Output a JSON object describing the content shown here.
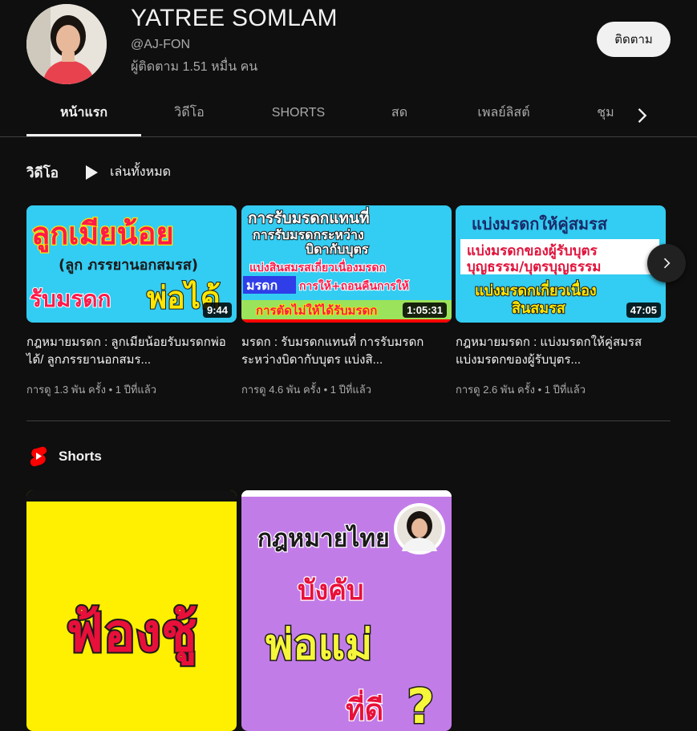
{
  "channel": {
    "name": "YATREE SOMLAM",
    "handle": "@AJ-FON",
    "subscribers": "ผู้ติดตาม 1.51 หมื่น คน",
    "subscribe_label": "ติดตาม"
  },
  "tabs": [
    "หน้าแรก",
    "วิดีโอ",
    "SHORTS",
    "สด",
    "เพลย์ลิสต์",
    "ชุม"
  ],
  "videos_section": {
    "title": "วิดีโอ",
    "play_all_label": "เล่นทั้งหมด",
    "items": [
      {
        "title": "กฎหมายมรดก : ลูกเมียน้อยรับมรดกพ่อได้/ ลูกภรรยานอกสมร...",
        "meta": "การดู 1.3 พัน ครั้ง • 1 ปีที่แล้ว",
        "duration": "9:44",
        "thumb_lines": [
          "ลูกเมียน้อย",
          "(ลูก ภรรยานอกสมรส)",
          "รับมรดก",
          "พ่อได้"
        ]
      },
      {
        "title": "มรดก : รับมรดกแทนที่ การรับมรดกระหว่างบิดากับบุตร แบ่งสิ...",
        "meta": "การดู 4.6 พัน ครั้ง • 1 ปีที่แล้ว",
        "duration": "1:05:31",
        "thumb_lines": [
          "การรับมรดกแทนที่",
          "การรับมรดกระหว่าง",
          "บิดากับบุตร",
          "แบ่งสินสมรสเกี่ยวเนื่องมรดก",
          "มรดก",
          "การให้+ถอนคืนการให้",
          "การตัดไม่ให้ได้รับมรดก"
        ]
      },
      {
        "title": "กฎหมายมรดก : แบ่งมรดกให้คู่สมรส แบ่งมรดกของผู้รับบุตร...",
        "meta": "การดู 2.6 พัน ครั้ง • 1 ปีที่แล้ว",
        "duration": "47:05",
        "thumb_lines": [
          "แบ่งมรดกให้คู่สมรส",
          "แบ่งมรดกของผู้รับบุตร",
          "บุญธรรม/บุตรบุญธรรม",
          "แบ่งมรดกเกี่ยวเนื่อง",
          "สินสมรส"
        ]
      }
    ]
  },
  "shorts_section": {
    "title": "Shorts",
    "items": [
      {
        "thumb_lines": [
          "ฟ้องชู้"
        ]
      },
      {
        "thumb_lines": [
          "กฎหมายไทย",
          "บังคับ",
          "พ่อแม่",
          "ที่ดี",
          "?"
        ]
      }
    ]
  },
  "colors": {
    "background": "#0f0f0f",
    "text": "#f1f1f1",
    "secondary_text": "#aaaaaa",
    "shorts_red": "#ff0000",
    "thumb_cyan": "#33ccf2",
    "short_yellow": "#ffef00",
    "short_purple": "#c27ce8"
  }
}
